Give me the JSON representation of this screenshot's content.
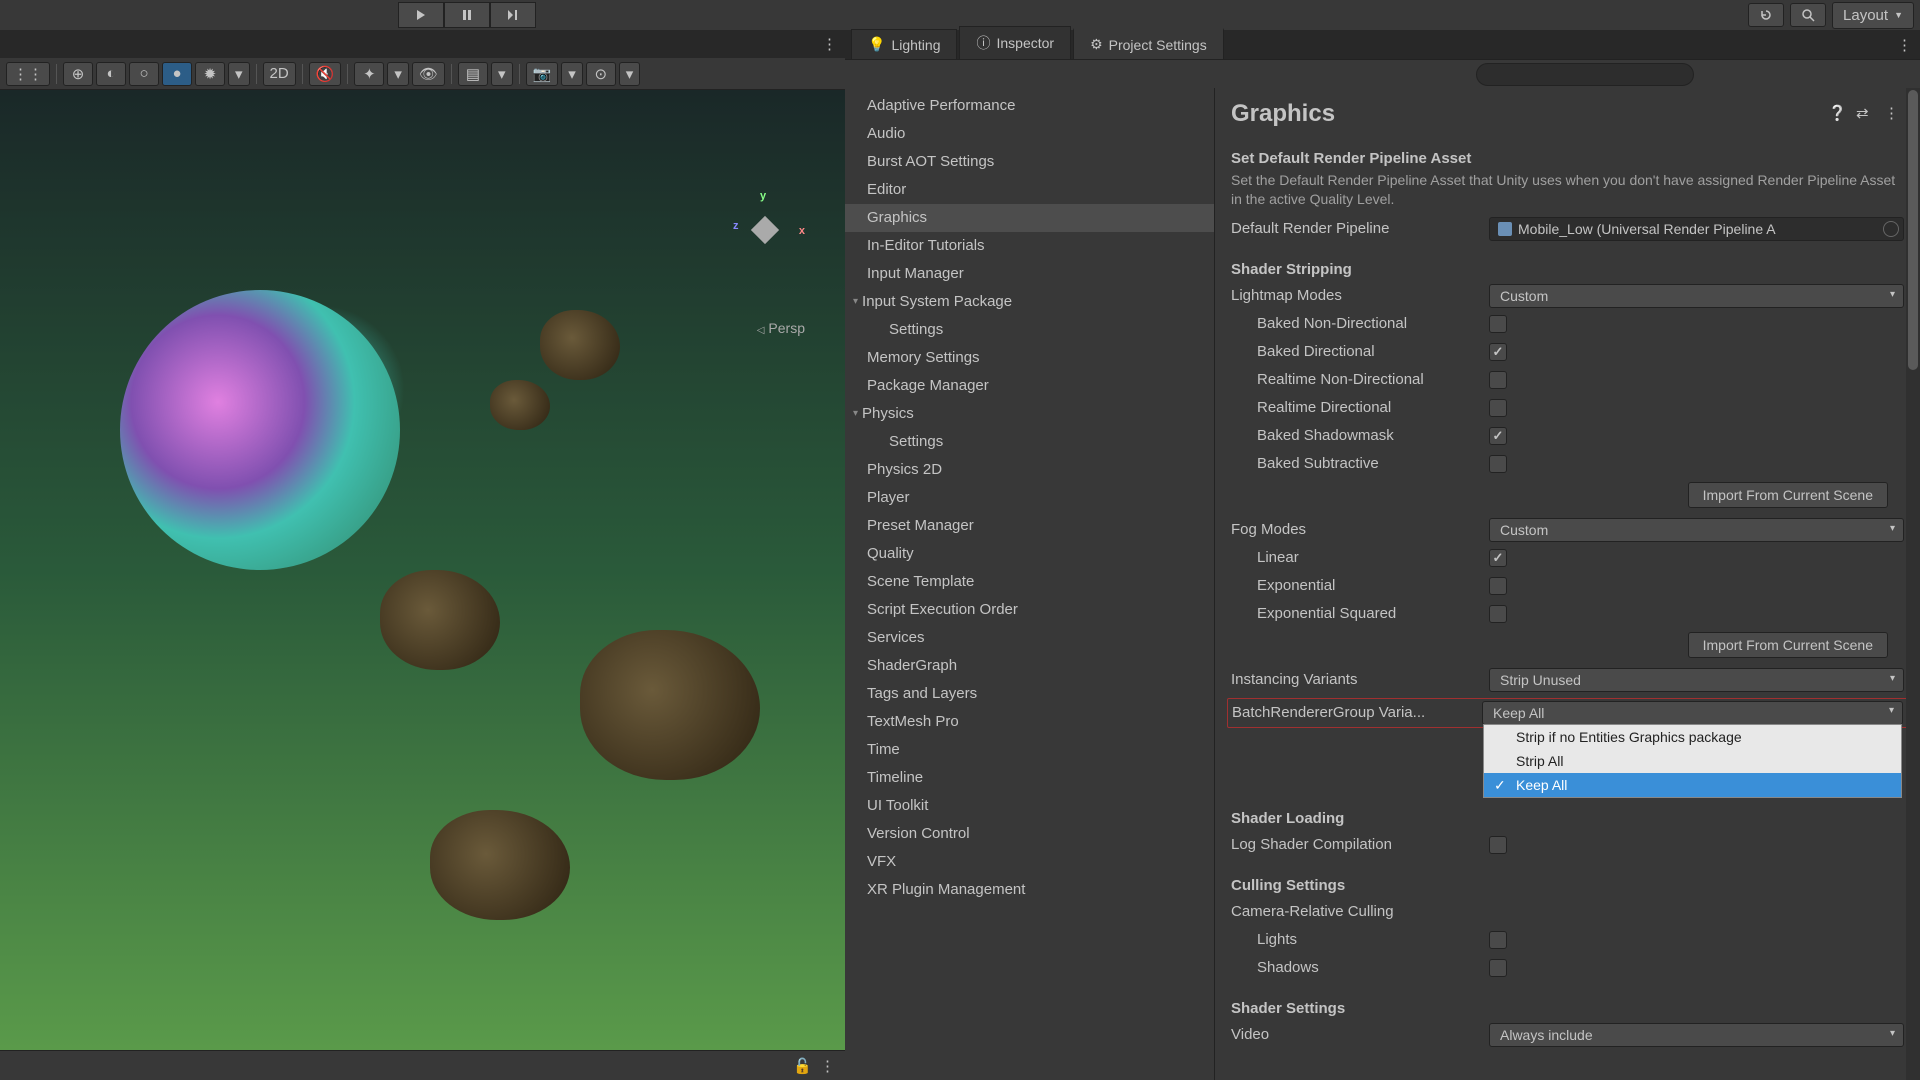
{
  "topbar": {
    "layout_label": "Layout"
  },
  "scene": {
    "persp_label": "Persp",
    "twod_label": "2D"
  },
  "tabs": {
    "lighting": "Lighting",
    "inspector": "Inspector",
    "project_settings": "Project Settings"
  },
  "sidebar": {
    "items": [
      "Adaptive Performance",
      "Audio",
      "Burst AOT Settings",
      "Editor",
      "Graphics",
      "In-Editor Tutorials",
      "Input Manager",
      "Input System Package",
      "Settings",
      "Memory Settings",
      "Package Manager",
      "Physics",
      "Settings",
      "Physics 2D",
      "Player",
      "Preset Manager",
      "Quality",
      "Scene Template",
      "Script Execution Order",
      "Services",
      "ShaderGraph",
      "Tags and Layers",
      "TextMesh Pro",
      "Time",
      "Timeline",
      "UI Toolkit",
      "Version Control",
      "VFX",
      "XR Plugin Management"
    ]
  },
  "details": {
    "title": "Graphics",
    "default_pipeline": {
      "title": "Set Default Render Pipeline Asset",
      "desc": "Set the Default Render Pipeline Asset that Unity uses when you don't have assigned Render Pipeline Asset in the active Quality Level.",
      "label": "Default Render Pipeline",
      "value": "Mobile_Low (Universal Render Pipeline A"
    },
    "shader_stripping": {
      "title": "Shader Stripping",
      "lightmap_modes": {
        "label": "Lightmap Modes",
        "value": "Custom"
      },
      "baked_non_dir": {
        "label": "Baked Non-Directional",
        "checked": false
      },
      "baked_dir": {
        "label": "Baked Directional",
        "checked": true
      },
      "realtime_non_dir": {
        "label": "Realtime Non-Directional",
        "checked": false
      },
      "realtime_dir": {
        "label": "Realtime Directional",
        "checked": false
      },
      "baked_shadowmask": {
        "label": "Baked Shadowmask",
        "checked": true
      },
      "baked_subtractive": {
        "label": "Baked Subtractive",
        "checked": false
      },
      "import_btn": "Import From Current Scene",
      "fog_modes": {
        "label": "Fog Modes",
        "value": "Custom"
      },
      "linear": {
        "label": "Linear",
        "checked": true
      },
      "exponential": {
        "label": "Exponential",
        "checked": false
      },
      "exponential_sq": {
        "label": "Exponential Squared",
        "checked": false
      },
      "instancing": {
        "label": "Instancing Variants",
        "value": "Strip Unused"
      },
      "brg": {
        "label": "BatchRendererGroup Varia...",
        "value": "Keep All"
      },
      "brg_options": [
        "Strip if no Entities Graphics package",
        "Strip All",
        "Keep All"
      ]
    },
    "shader_loading": {
      "title": "Shader Loading",
      "log_compilation": {
        "label": "Log Shader Compilation",
        "checked": false
      }
    },
    "culling": {
      "title": "Culling Settings",
      "camera_relative": "Camera-Relative Culling",
      "lights": {
        "label": "Lights",
        "checked": false
      },
      "shadows": {
        "label": "Shadows",
        "checked": false
      }
    },
    "shader_settings": {
      "title": "Shader Settings",
      "video": {
        "label": "Video",
        "value": "Always include"
      }
    }
  }
}
